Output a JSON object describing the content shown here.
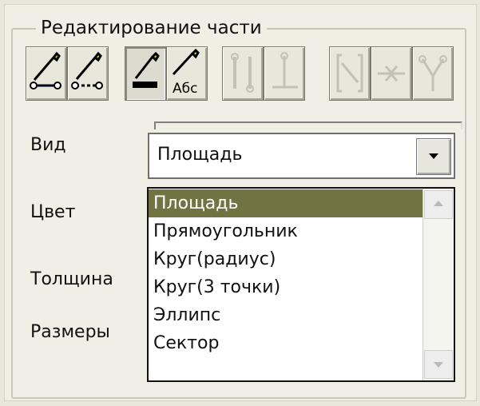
{
  "panel": {
    "title": "Редактирование части"
  },
  "toolbar": {
    "buttons": [
      {
        "icon": "edit-point-icon",
        "enabled": true,
        "pressed": false
      },
      {
        "icon": "edit-dotted-point-icon",
        "enabled": true,
        "pressed": false
      },
      {
        "icon": "edit-area-icon",
        "enabled": true,
        "pressed": true
      },
      {
        "icon": "edit-label-icon",
        "enabled": true,
        "pressed": false,
        "text": "Абс"
      },
      {
        "icon": "link-icon",
        "enabled": false,
        "pressed": false
      },
      {
        "icon": "branch-icon",
        "enabled": false,
        "pressed": false
      },
      {
        "icon": "bracket-link-icon",
        "enabled": false,
        "pressed": false
      },
      {
        "icon": "merge-icon",
        "enabled": false,
        "pressed": false
      },
      {
        "icon": "split-icon",
        "enabled": false,
        "pressed": false
      }
    ]
  },
  "fields": {
    "view_label": "Вид",
    "color_label": "Цвет",
    "thickness_label": "Толщина",
    "sizes_label": "Размеры"
  },
  "combo": {
    "selected_value": "Площадь"
  },
  "dropdown": {
    "options": [
      "Площадь",
      "Прямоугольник",
      "Круг(радиус)",
      "Круг(3 точки)",
      "Эллипс",
      "Сектор"
    ],
    "selected_index": 0
  },
  "colors": {
    "selection": "#717442",
    "background": "#f0efe6"
  }
}
